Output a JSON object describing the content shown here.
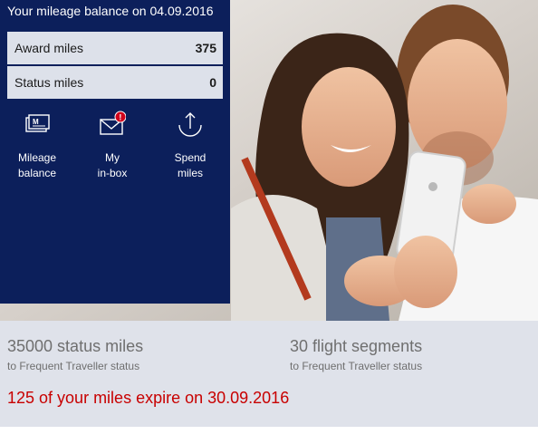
{
  "panel": {
    "title": "Your mileage balance on 04.09.2016",
    "rows": [
      {
        "label": "Award miles",
        "value": "375"
      },
      {
        "label": "Status miles",
        "value": "0"
      }
    ],
    "actions": [
      {
        "line1": "Mileage",
        "line2": "balance",
        "icon": "mileage-card-icon"
      },
      {
        "line1": "My",
        "line2": "in-box",
        "icon": "envelope-icon",
        "badge": "!"
      },
      {
        "line1": "Spend",
        "line2": "miles",
        "icon": "spend-arrow-icon"
      }
    ]
  },
  "info": {
    "stats": [
      {
        "big": "35000 status miles",
        "small": "to Frequent Traveller status"
      },
      {
        "big": "30 flight segments",
        "small": "to Frequent Traveller status"
      }
    ],
    "expire": "125 of your miles expire on 30.09.2016"
  },
  "colors": {
    "panel_bg": "#0c1f5b",
    "row_bg": "#dde1ea",
    "info_bg": "#dfe2ea",
    "expire_red": "#c80000",
    "badge_red": "#d0021b"
  }
}
